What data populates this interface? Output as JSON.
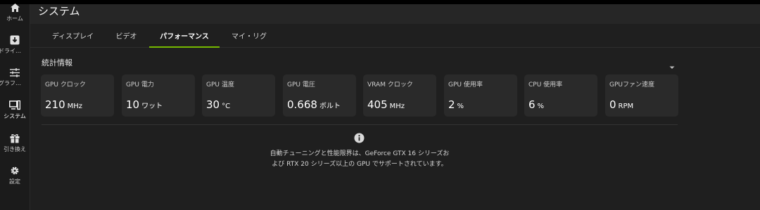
{
  "sidebar": {
    "items": [
      {
        "label": "ホーム",
        "icon": "home-icon"
      },
      {
        "label": "ドライ…",
        "icon": "download-icon"
      },
      {
        "label": "グラフ…",
        "icon": "sliders-icon"
      },
      {
        "label": "システム",
        "icon": "system-icon",
        "active": true
      },
      {
        "label": "引き換え",
        "icon": "gift-icon"
      },
      {
        "label": "設定",
        "icon": "gear-icon"
      }
    ]
  },
  "header": {
    "title": "システム"
  },
  "tabs": [
    {
      "label": "ディスプレイ"
    },
    {
      "label": "ビデオ"
    },
    {
      "label": "パフォーマンス",
      "active": true
    },
    {
      "label": "マイ・リグ"
    }
  ],
  "stats": {
    "title": "統計情報",
    "cards": [
      {
        "label": "GPU クロック",
        "value": "210",
        "unit": "MHz"
      },
      {
        "label": "GPU 電力",
        "value": "10",
        "unit": "ワット"
      },
      {
        "label": "GPU 温度",
        "value": "30",
        "unit": "°C"
      },
      {
        "label": "GPU 電圧",
        "value": "0.668",
        "unit": "ボルト"
      },
      {
        "label": "VRAM クロック",
        "value": "405",
        "unit": "MHz"
      },
      {
        "label": "GPU 使用率",
        "value": "2",
        "unit": "%"
      },
      {
        "label": "CPU 使用率",
        "value": "6",
        "unit": "%"
      },
      {
        "label": "GPUファン速度",
        "value": "0",
        "unit": "RPM"
      }
    ]
  },
  "info": {
    "line1": "自動チューニングと性能限界は、GeForce GTX 16 シリーズお",
    "line2": "よび RTX 20 シリーズ以上の GPU でサポートされています。"
  },
  "colors": {
    "accent": "#76b900",
    "background": "#1f1f1f",
    "card": "#2a2a2a"
  }
}
